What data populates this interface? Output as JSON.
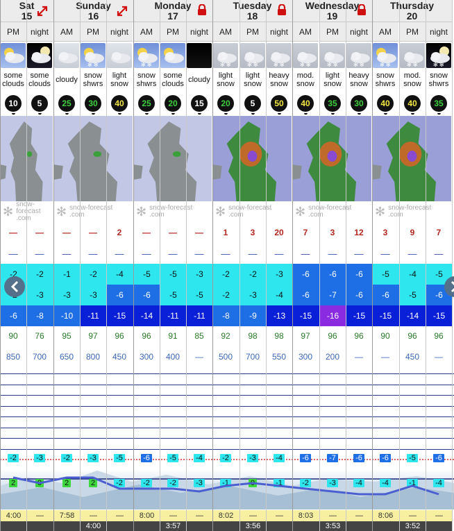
{
  "colors": {
    "temp_lightcyan": "#2ee6ee",
    "temp_cyan": "#14c8e6",
    "temp_blue": "#1e6ee6",
    "temp_darkblue": "#0a20d8",
    "temp_deepblue": "#1432c8",
    "temp_purple": "#8a2be2",
    "snow_red": "#b3261e",
    "rain_blue": "#3350b0"
  },
  "days": [
    {
      "name": "Sat",
      "date": "15",
      "icon": "expand-arrow-icon"
    },
    {
      "name": "Sunday",
      "date": "16",
      "icon": "expand-arrow-icon"
    },
    {
      "name": "Monday",
      "date": "17",
      "icon": "lock-icon"
    },
    {
      "name": "Tuesday",
      "date": "18",
      "icon": "lock-icon"
    },
    {
      "name": "Wednesday",
      "date": "19",
      "icon": "lock-icon"
    },
    {
      "name": "Thursday",
      "date": "20",
      "icon": ""
    }
  ],
  "periods": [
    "PM",
    "night",
    "AM",
    "PM",
    "night",
    "AM",
    "PM",
    "night",
    "AM",
    "PM",
    "night",
    "AM",
    "PM",
    "night",
    "AM",
    "PM",
    "night"
  ],
  "weather_icons": [
    "sun-cloud-icon",
    "moon-cloud-icon",
    "cloud-icon",
    "sun-snow-icon",
    "cloud-icon",
    "sun-snow-icon",
    "sun-cloud-icon",
    "night-icon",
    "snow-cloud-icon",
    "snow-cloud-icon",
    "snow-cloud-icon",
    "snow-cloud-icon",
    "snow-cloud-icon",
    "snow-cloud-icon",
    "sun-snow-icon",
    "snow-cloud-icon",
    "moon-snow-icon"
  ],
  "weather_text": [
    [
      "some",
      "clouds"
    ],
    [
      "some",
      "clouds"
    ],
    [
      "cloudy",
      ""
    ],
    [
      "snow",
      "shwrs"
    ],
    [
      "light",
      "snow"
    ],
    [
      "snow",
      "shwrs"
    ],
    [
      "some",
      "clouds"
    ],
    [
      "cloudy",
      ""
    ],
    [
      "light",
      "snow"
    ],
    [
      "light",
      "snow"
    ],
    [
      "heavy",
      "snow"
    ],
    [
      "mod.",
      "snow"
    ],
    [
      "light",
      "snow"
    ],
    [
      "heavy",
      "snow"
    ],
    [
      "snow",
      "shwrs"
    ],
    [
      "mod.",
      "snow"
    ],
    [
      "snow",
      "shwrs"
    ]
  ],
  "wind": [
    "10",
    "5",
    "25",
    "30",
    "40",
    "25",
    "20",
    "15",
    "20",
    "5",
    "50",
    "40",
    "35",
    "30",
    "40",
    "40",
    "35"
  ],
  "wind_color": [
    "#fff",
    "#fff",
    "#3ecf3e",
    "#3ecf3e",
    "#f2e640",
    "#3ecf3e",
    "#3ecf3e",
    "#fff",
    "#3ecf3e",
    "#fff",
    "#f2e640",
    "#f2e640",
    "#3ecf3e",
    "#3ecf3e",
    "#f2e640",
    "#f2e640",
    "#3ecf3e"
  ],
  "map_watermark": [
    "snow-forecast",
    ".com"
  ],
  "snow": [
    "—",
    "—",
    "—",
    "—",
    "2",
    "—",
    "—",
    "—",
    "1",
    "3",
    "20",
    "7",
    "3",
    "12",
    "3",
    "9",
    "7"
  ],
  "rain": [
    "—",
    "—",
    "—",
    "—",
    "—",
    "—",
    "—",
    "—",
    "—",
    "—",
    "—",
    "—",
    "—",
    "—",
    "—",
    "—",
    "—"
  ],
  "temp_max": [
    "-2",
    "-2",
    "-1",
    "-2",
    "-4",
    "-5",
    "-5",
    "-3",
    "-2",
    "-2",
    "-3",
    "-6",
    "-6",
    "-6",
    "-5",
    "-4",
    "-5"
  ],
  "temp_min": [
    "-2",
    "-3",
    "-3",
    "-3",
    "-6",
    "-6",
    "-5",
    "-5",
    "-2",
    "-3",
    "-4",
    "-6",
    "-7",
    "-6",
    "-6",
    "-5",
    "-6"
  ],
  "temp_chill": [
    "-6",
    "-8",
    "-10",
    "-11",
    "-15",
    "-14",
    "-11",
    "-11",
    "-8",
    "-9",
    "-13",
    "-15",
    "-16",
    "-15",
    "-15",
    "-14",
    "-15"
  ],
  "humidity": [
    "90",
    "76",
    "95",
    "97",
    "96",
    "96",
    "91",
    "85",
    "92",
    "98",
    "98",
    "97",
    "96",
    "96",
    "90",
    "96",
    "96"
  ],
  "freezing_level": [
    "850",
    "700",
    "650",
    "800",
    "450",
    "300",
    "400",
    "—",
    "500",
    "700",
    "550",
    "300",
    "200",
    "—",
    "—",
    "450",
    "—"
  ],
  "summit_temp": [
    "-2",
    "-3",
    "-2",
    "-3",
    "-5",
    "-6",
    "-5",
    "-4",
    "-2",
    "-3",
    "-4",
    "-6",
    "-7",
    "-6",
    "-6",
    "-5",
    "-6"
  ],
  "base_temp": [
    "2",
    "0",
    "2",
    "2",
    "-2",
    "-2",
    "-2",
    "-3",
    "-1",
    "0",
    "-1",
    "-2",
    "-3",
    "-4",
    "-4",
    "-1",
    "-4"
  ],
  "sunrise": [
    "4:00",
    "—",
    "7:58",
    "—",
    "—",
    "8:00",
    "—",
    "—",
    "8:02",
    "—",
    "—",
    "8:03",
    "—",
    "—",
    "8:06",
    "—",
    "—"
  ],
  "sunset": [
    "",
    "",
    "",
    "4:00",
    "",
    "",
    "3:57",
    "",
    "",
    "3:56",
    "",
    "",
    "3:53",
    "",
    "",
    "3:52",
    ""
  ]
}
